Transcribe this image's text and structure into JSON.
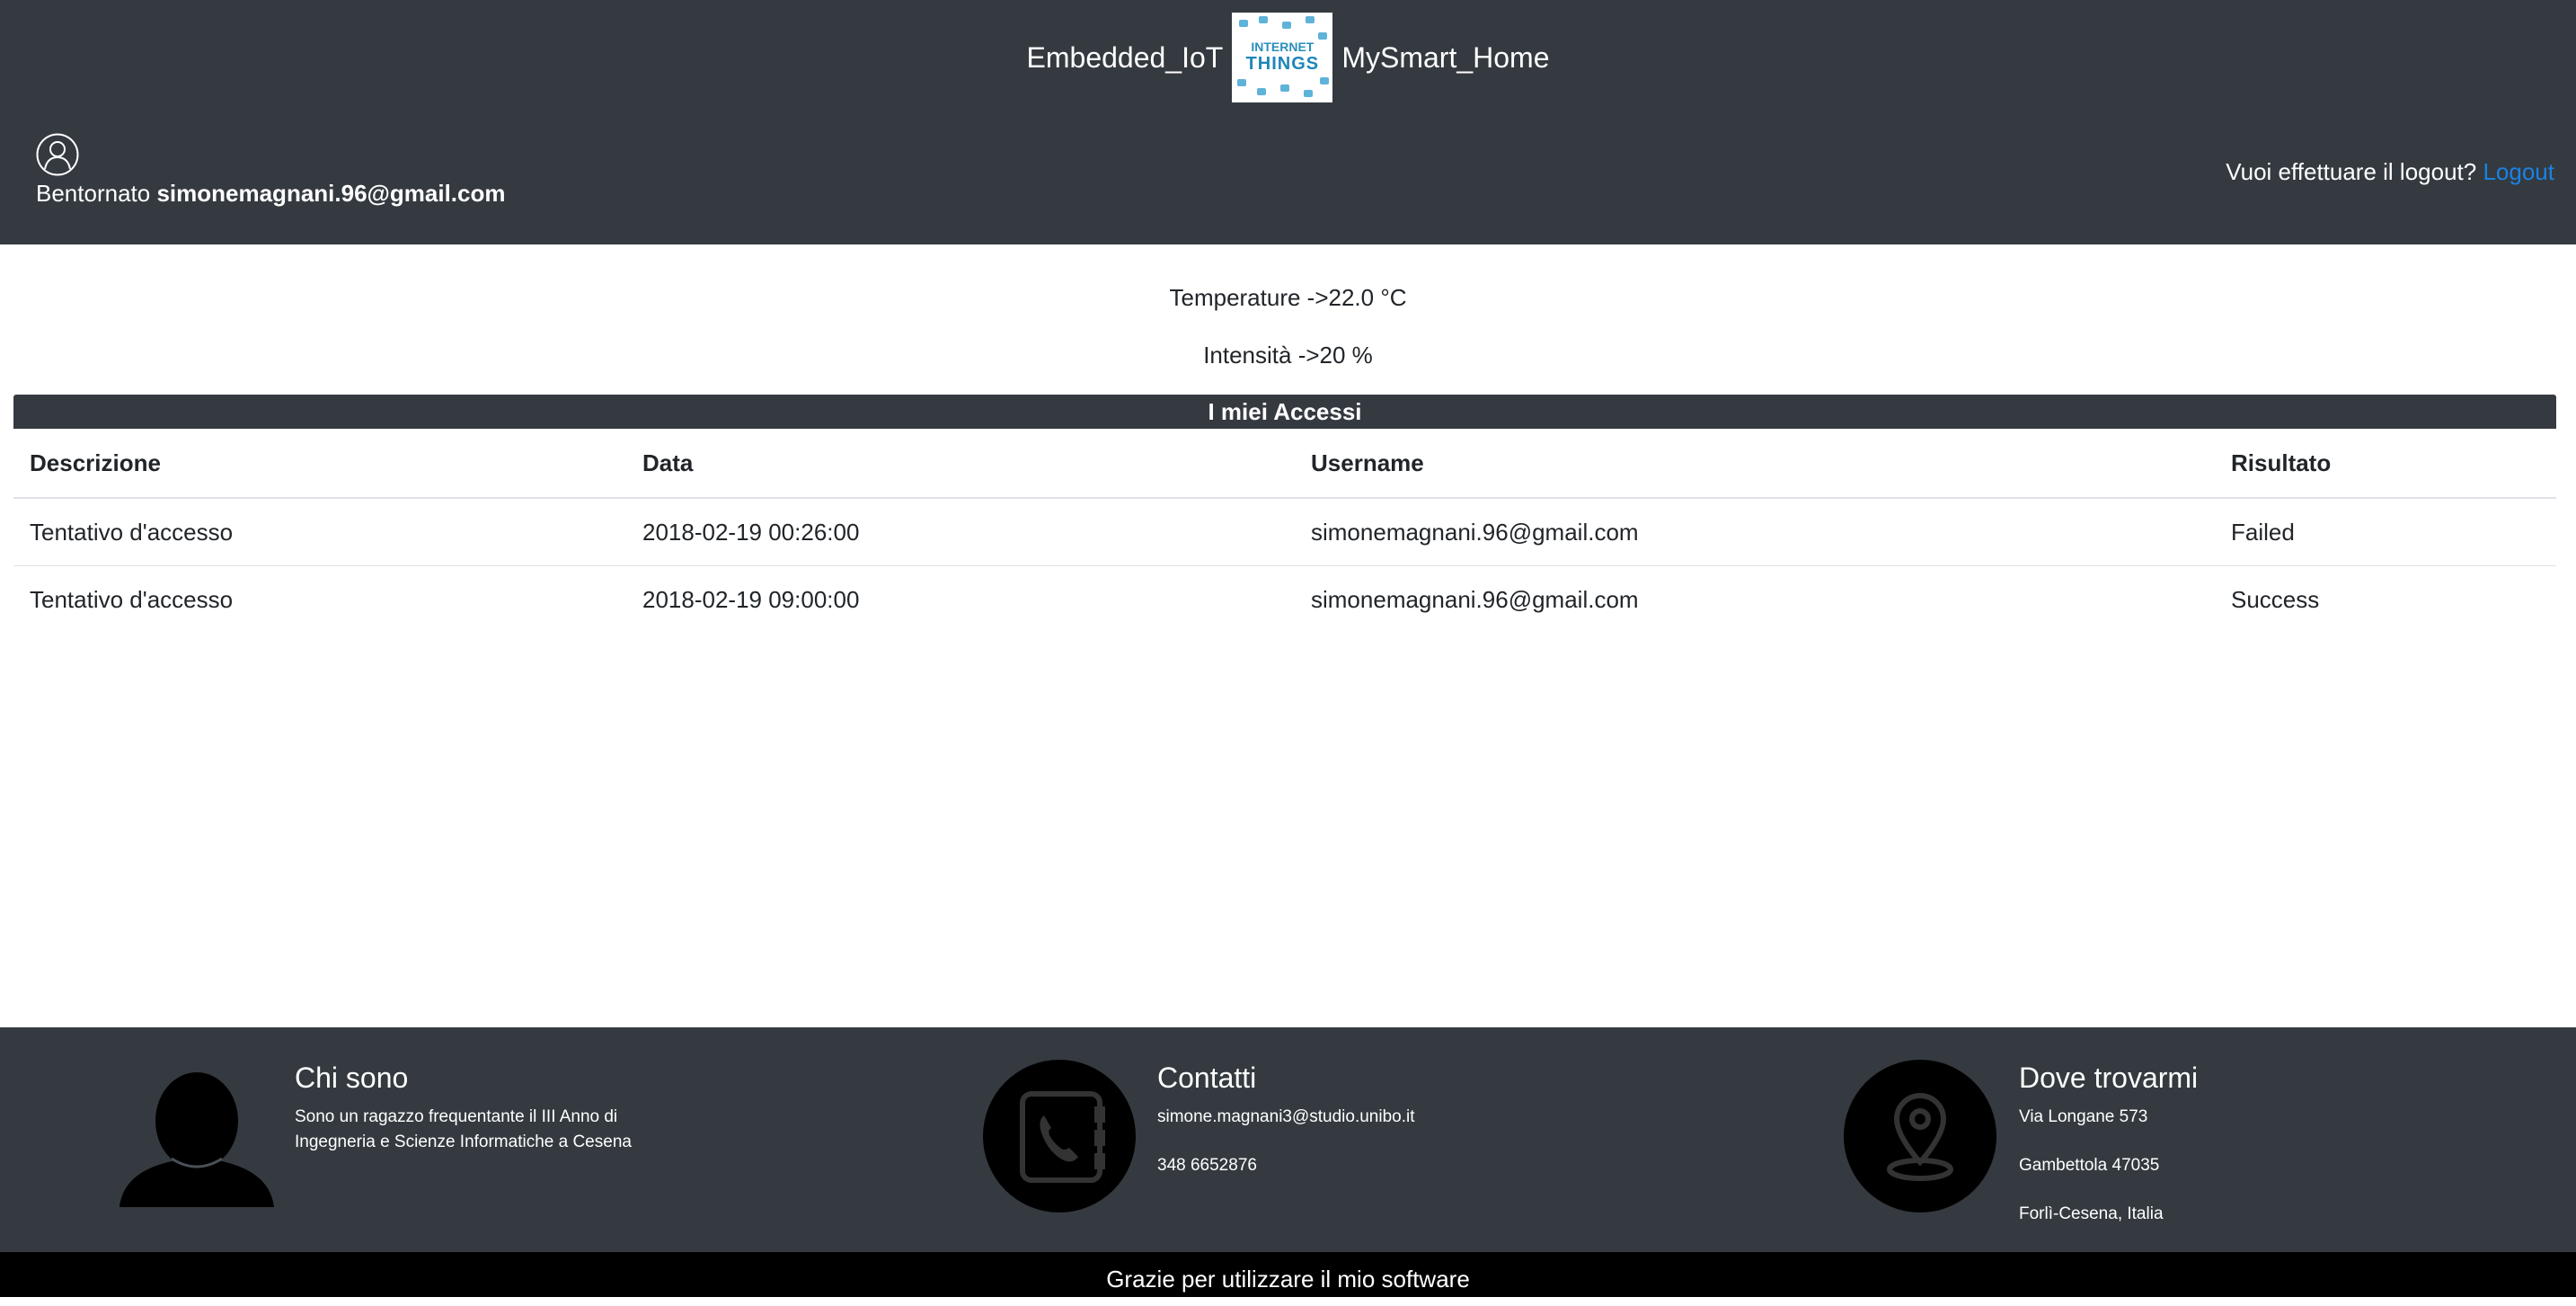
{
  "header": {
    "brand_left": "Embedded_IoT",
    "brand_right": "MySmart_Home",
    "logo_line1": "INTERNET",
    "logo_line2": "THINGS",
    "welcome_prefix": "Bentornato",
    "user_email": "simonemagnani.96@gmail.com",
    "logout_question": "Vuoi effettuare il logout?",
    "logout_label": "Logout",
    "accent_color": "#1a82e2"
  },
  "readings": {
    "temperature": "Temperature ->22.0 °C",
    "intensity": "Intensità ->20 %"
  },
  "accessi": {
    "title": "I miei Accessi",
    "columns": [
      "Descrizione",
      "Data",
      "Username",
      "Risultato"
    ],
    "rows": [
      [
        "Tentativo d'accesso",
        "2018-02-19 00:26:00",
        "simonemagnani.96@gmail.com",
        "Failed"
      ],
      [
        "Tentativo d'accesso",
        "2018-02-19 09:00:00",
        "simonemagnani.96@gmail.com",
        "Success"
      ]
    ]
  },
  "footer": {
    "about": {
      "icon": "person-silhouette-icon",
      "title": "Chi sono",
      "line1": "Sono un ragazzo frequentante il III Anno di",
      "line2": "Ingegneria e Scienze Informatiche a Cesena"
    },
    "contacts": {
      "icon": "phone-book-icon",
      "title": "Contatti",
      "email": "simone.magnani3@studio.unibo.it",
      "phone": "348 6652876"
    },
    "location": {
      "icon": "map-pin-icon",
      "title": "Dove trovarmi",
      "street": "Via Longane 573",
      "city": "Gambettola 47035",
      "region": "Forlì-Cesena, Italia"
    }
  },
  "bottom_bar": "Grazie per utilizzare il mio software"
}
